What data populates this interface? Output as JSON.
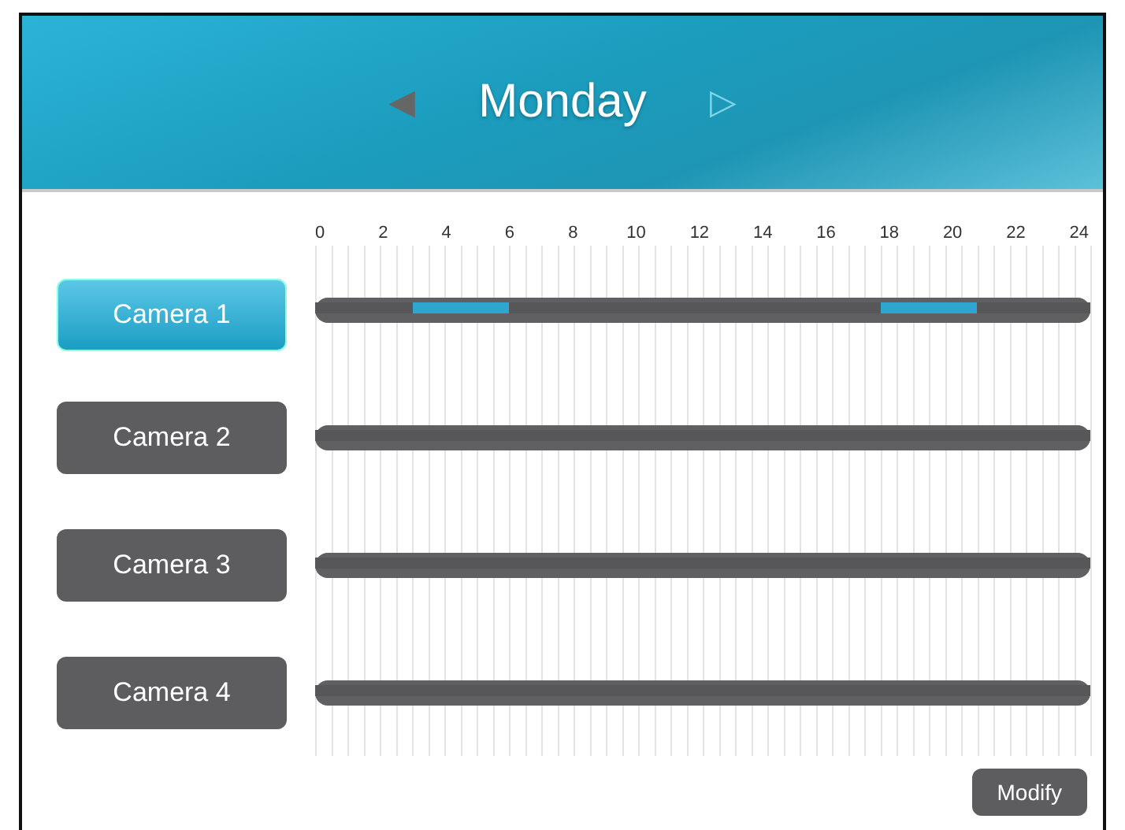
{
  "header": {
    "prev": "◀",
    "title": "Monday",
    "next": "▷"
  },
  "hours": [
    "0",
    "2",
    "4",
    "6",
    "8",
    "10",
    "12",
    "14",
    "16",
    "18",
    "20",
    "22",
    "24"
  ],
  "cameras": [
    {
      "name": "Camera 1",
      "selected": true,
      "slots": [
        false,
        false,
        false,
        false,
        false,
        false,
        true,
        true,
        true,
        true,
        true,
        true,
        false,
        false,
        false,
        false,
        false,
        false,
        false,
        false,
        false,
        false,
        false,
        false,
        false,
        false,
        false,
        false,
        false,
        false,
        false,
        false,
        false,
        false,
        false,
        true,
        true,
        true,
        true,
        true,
        true,
        false,
        false,
        false,
        false,
        false,
        false,
        false
      ]
    },
    {
      "name": "Camera 2",
      "selected": false,
      "slots": [
        false,
        false,
        false,
        false,
        false,
        false,
        false,
        false,
        false,
        false,
        false,
        false,
        false,
        false,
        false,
        false,
        false,
        false,
        false,
        false,
        false,
        false,
        false,
        false,
        false,
        false,
        false,
        false,
        false,
        false,
        false,
        false,
        false,
        false,
        false,
        false,
        false,
        false,
        false,
        false,
        false,
        false,
        false,
        false,
        false,
        false,
        false,
        false
      ]
    },
    {
      "name": "Camera 3",
      "selected": false,
      "slots": [
        false,
        false,
        false,
        false,
        false,
        false,
        false,
        false,
        false,
        false,
        false,
        false,
        false,
        false,
        false,
        false,
        false,
        false,
        false,
        false,
        false,
        false,
        false,
        false,
        false,
        false,
        false,
        false,
        false,
        false,
        false,
        false,
        false,
        false,
        false,
        false,
        false,
        false,
        false,
        false,
        false,
        false,
        false,
        false,
        false,
        false,
        false,
        false
      ]
    },
    {
      "name": "Camera 4",
      "selected": false,
      "slots": [
        false,
        false,
        false,
        false,
        false,
        false,
        false,
        false,
        false,
        false,
        false,
        false,
        false,
        false,
        false,
        false,
        false,
        false,
        false,
        false,
        false,
        false,
        false,
        false,
        false,
        false,
        false,
        false,
        false,
        false,
        false,
        false,
        false,
        false,
        false,
        false,
        false,
        false,
        false,
        false,
        false,
        false,
        false,
        false,
        false,
        false,
        false,
        false
      ]
    }
  ],
  "modify": "Modify"
}
